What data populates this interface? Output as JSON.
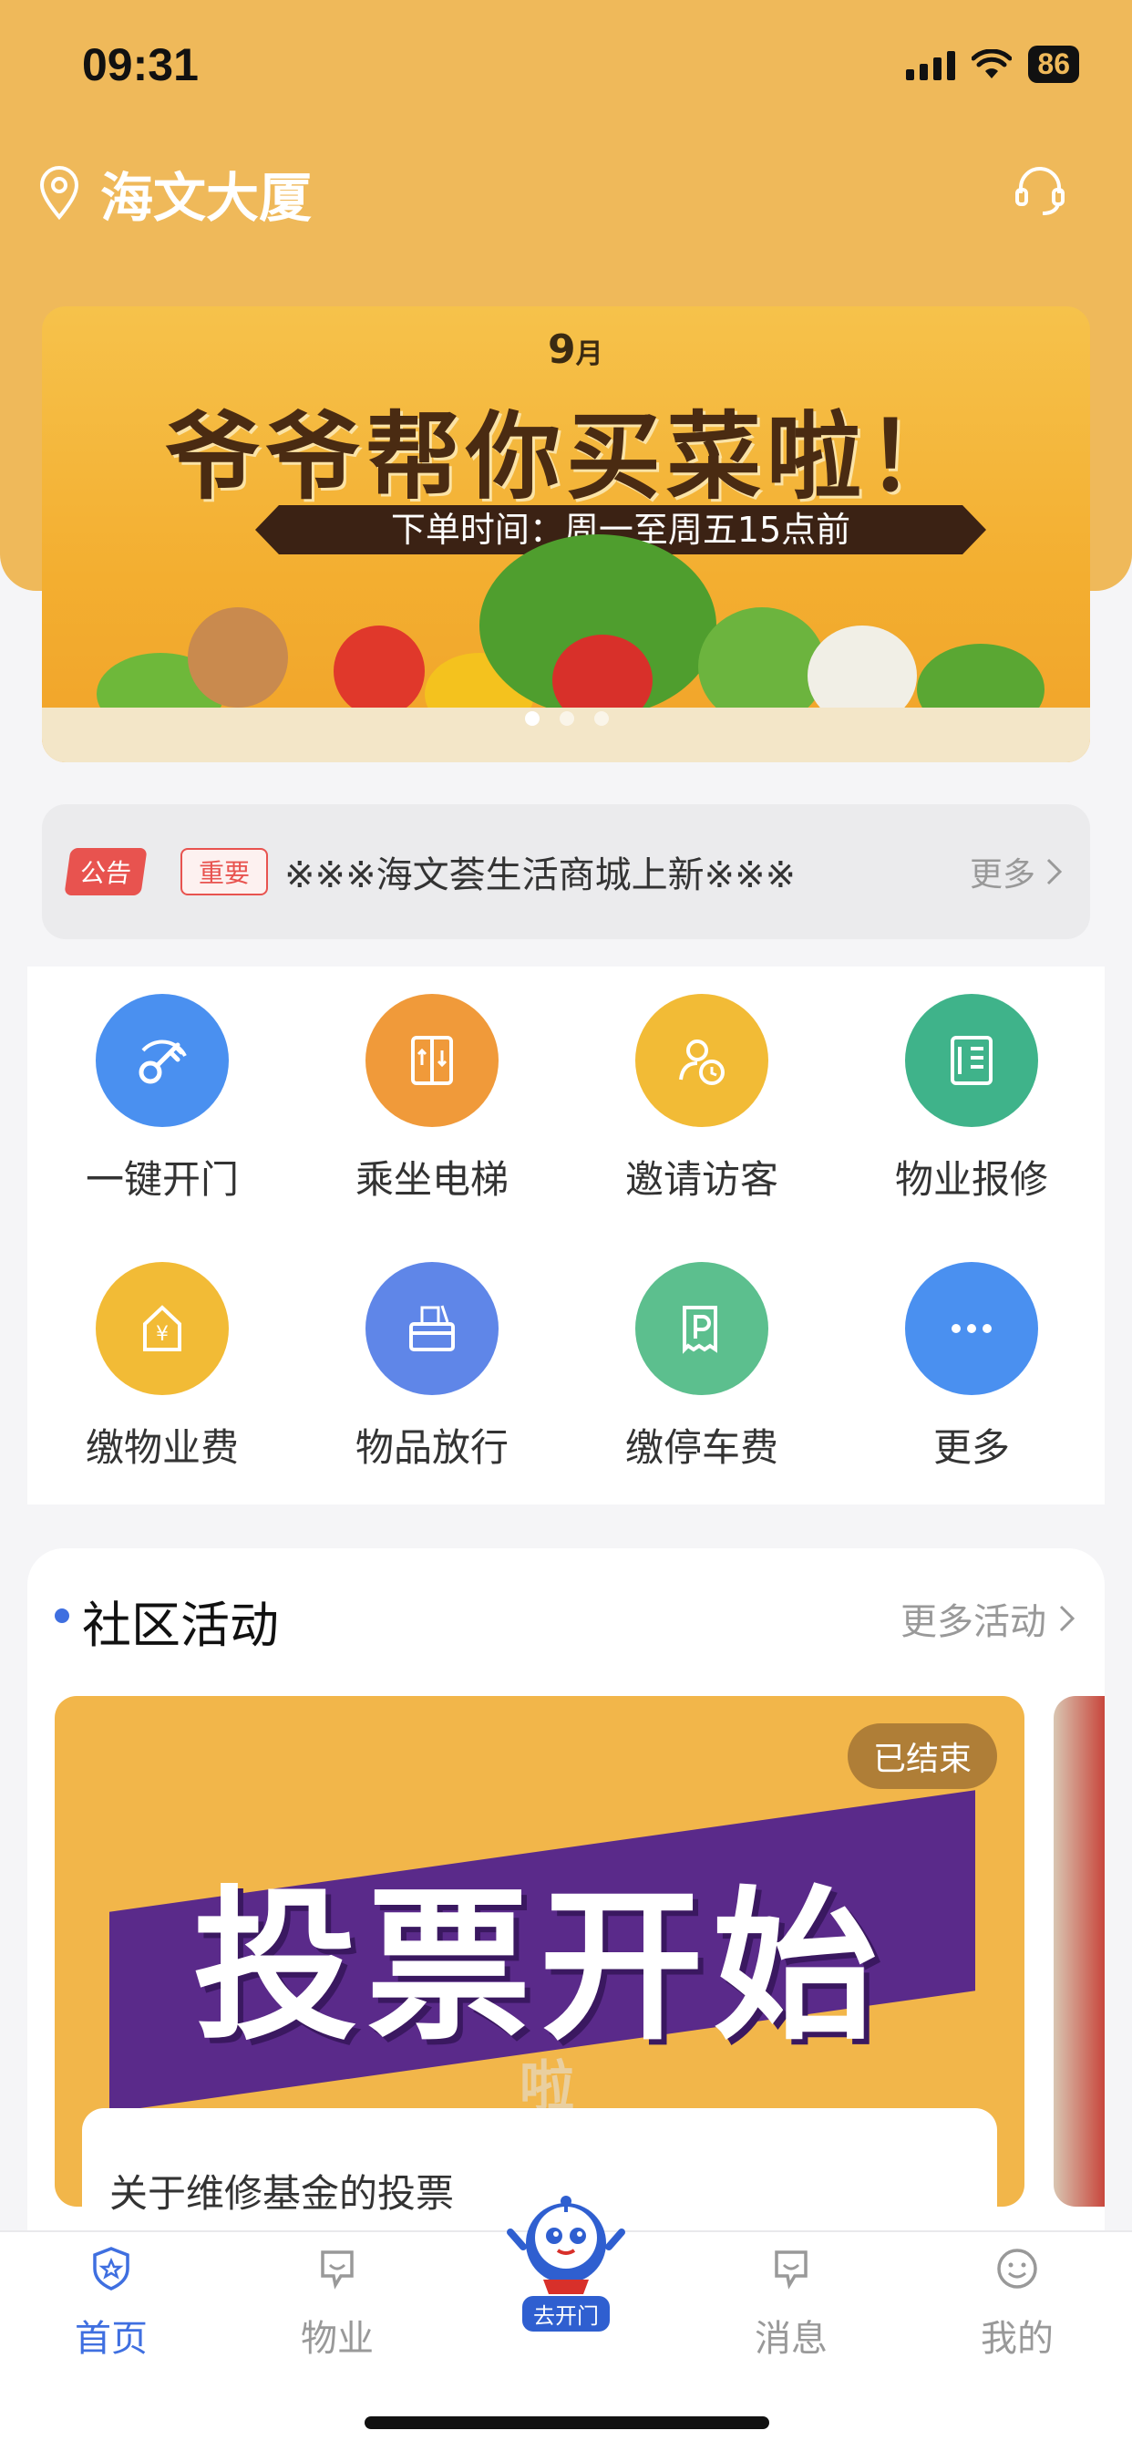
{
  "status_bar": {
    "time": "09:31",
    "battery": "86"
  },
  "header": {
    "location": "海文大厦"
  },
  "banner": {
    "month": "9",
    "month_unit": "月",
    "title": "爷爷帮你买菜啦！",
    "subtitle": "下单时间：周一至周五15点前",
    "dots": 3,
    "active_dot": 1
  },
  "notice": {
    "tag": "公告",
    "badge": "重要",
    "text": "※※※海文荟生活商城上新※※※",
    "more": "更多"
  },
  "services": [
    {
      "label": "一键开门",
      "icon": "key-icon",
      "color": "#4a90f0"
    },
    {
      "label": "乘坐电梯",
      "icon": "elevator-icon",
      "color": "#f09a3a"
    },
    {
      "label": "邀请访客",
      "icon": "visitor-icon",
      "color": "#f2bb36"
    },
    {
      "label": "物业报修",
      "icon": "repair-icon",
      "color": "#3fb38a"
    },
    {
      "label": "缴物业费",
      "icon": "property-fee-icon",
      "color": "#f2bb36"
    },
    {
      "label": "物品放行",
      "icon": "package-icon",
      "color": "#5f86e8"
    },
    {
      "label": "缴停车费",
      "icon": "parking-icon",
      "color": "#5cbf8e"
    },
    {
      "label": "更多",
      "icon": "more-icon",
      "color": "#4a90f0"
    }
  ],
  "activity": {
    "title": "社区活动",
    "more": "更多活动",
    "card": {
      "image_title": "投票开始",
      "image_sub": "啦",
      "status": "已结束",
      "caption": "关于维修基金的投票"
    }
  },
  "tabbar": {
    "items": [
      {
        "label": "首页",
        "icon": "home-icon",
        "active": true
      },
      {
        "label": "物业",
        "icon": "property-icon",
        "active": false
      },
      {
        "label": "消息",
        "icon": "message-icon",
        "active": false
      },
      {
        "label": "我的",
        "icon": "profile-icon",
        "active": false
      }
    ],
    "center_label": "去开门"
  },
  "colors": {
    "header": "#efb95a",
    "accent": "#3f6fe0",
    "notice_red": "#e8534f"
  }
}
